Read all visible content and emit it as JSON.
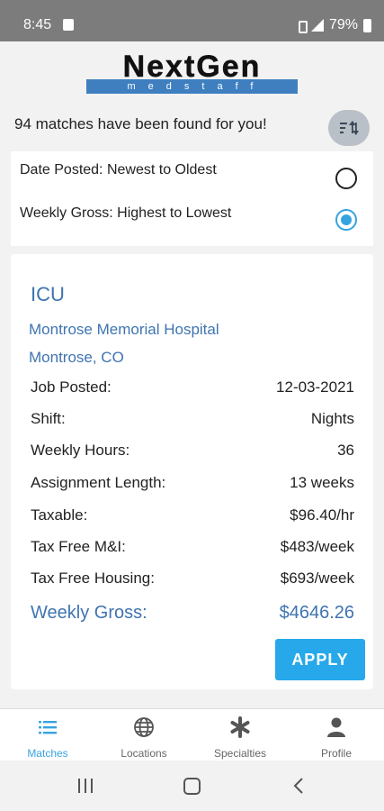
{
  "status_bar": {
    "time": "8:45",
    "battery": "79%"
  },
  "header": {
    "logo_word": "NextGen",
    "logo_sub": "medstaff"
  },
  "results": {
    "count_text": "94 matches have been found for you!"
  },
  "sort": {
    "options": [
      {
        "label": "Date Posted: Newest to Oldest",
        "selected": false
      },
      {
        "label": "Weekly Gross: Highest to Lowest",
        "selected": true
      }
    ]
  },
  "job": {
    "title": "ICU",
    "hospital": "Montrose Memorial Hospital",
    "location": "Montrose, CO",
    "details": [
      {
        "label": "Job Posted:",
        "value": "12-03-2021"
      },
      {
        "label": "Shift:",
        "value": "Nights"
      },
      {
        "label": "Weekly Hours:",
        "value": "36"
      },
      {
        "label": "Assignment Length:",
        "value": "13 weeks"
      },
      {
        "label": "Taxable:",
        "value": "$96.40/hr"
      },
      {
        "label": "Tax Free M&I:",
        "value": "$483/week"
      },
      {
        "label": "Tax Free Housing:",
        "value": "$693/week"
      }
    ],
    "gross_label": "Weekly Gross:",
    "gross_value": "$4646.26",
    "apply_label": "APPLY"
  },
  "bottom_nav": {
    "items": [
      {
        "label": "Matches",
        "icon": "list-icon",
        "active": true
      },
      {
        "label": "Locations",
        "icon": "globe-icon",
        "active": false
      },
      {
        "label": "Specialties",
        "icon": "asterisk-icon",
        "active": false
      },
      {
        "label": "Profile",
        "icon": "person-icon",
        "active": false
      }
    ]
  },
  "colors": {
    "accent": "#36a3e0",
    "link_blue": "#3f74b0",
    "apply_button": "#26a8ea",
    "status_bar": "#7c7c7c"
  }
}
